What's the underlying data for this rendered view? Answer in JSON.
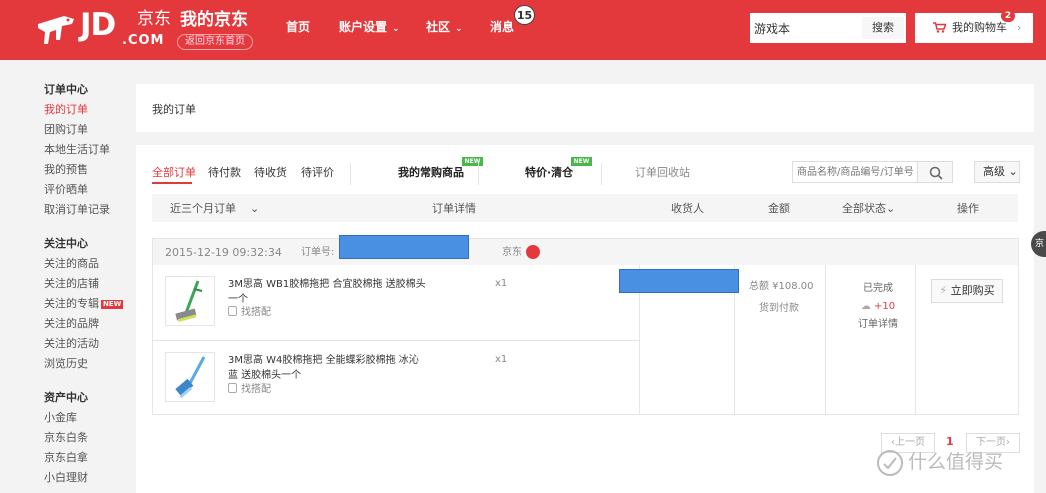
{
  "header": {
    "logo_jd": "JD",
    "logo_cn": "京东",
    "logo_com": ".COM",
    "my_jd": "我的京东",
    "back_home": "返回京东首页",
    "nav": [
      {
        "label": "首页"
      },
      {
        "label": "账户设置",
        "caret": "⌄"
      },
      {
        "label": "社区",
        "caret": "⌄"
      },
      {
        "label": "消息"
      }
    ],
    "message_count": "15",
    "search_value": "游戏本",
    "search_button": "搜索",
    "cart_label": "我的购物车",
    "cart_count": "2",
    "cart_arrow": "›"
  },
  "sidebar": {
    "groups": [
      {
        "title": "订单中心",
        "items": [
          "我的订单",
          "团购订单",
          "本地生活订单",
          "我的预售",
          "评价晒单",
          "取消订单记录"
        ]
      },
      {
        "title": "关注中心",
        "items": [
          "关注的商品",
          "关注的店铺",
          "关注的专辑",
          "关注的品牌",
          "关注的活动",
          "浏览历史"
        ]
      },
      {
        "title": "资产中心",
        "items": [
          "小金库",
          "京东白条",
          "京东白拿",
          "小白理财"
        ]
      }
    ],
    "new_tag": "NEW"
  },
  "page_title": "我的订单",
  "tabs": {
    "all": "全部订单",
    "pending_pay": "待付款",
    "pending_receive": "待收货",
    "pending_review": "待评价",
    "frequent": "我的常购商品",
    "clearance": "特价·清仓",
    "recycle": "订单回收站",
    "new_badge": "NEW"
  },
  "order_search": {
    "placeholder": "商品名称/商品编号/订单号",
    "advanced": "高级",
    "advanced_caret": "⌄"
  },
  "table_header": {
    "period": "近三个月订单",
    "period_caret": "⌄",
    "details": "订单详情",
    "receiver": "收货人",
    "amount": "金额",
    "status": "全部状态",
    "status_caret": "⌄",
    "actions": "操作"
  },
  "order": {
    "date": "2015-12-19 09:32:34",
    "number_label": "订单号:",
    "shop": "京东",
    "products": [
      {
        "name": "3M思高 WB1胶棉拖把 合宜胶棉拖 送胶棉头一个",
        "qty": "x1",
        "pair": "找搭配"
      },
      {
        "name": "3M思高 W4胶棉拖把 全能蝶彩胶棉拖 冰沁蓝 送胶棉头一个",
        "qty": "x1",
        "pair": "找搭配"
      }
    ],
    "total": "总额 ¥108.00",
    "payment": "货到付款",
    "status": "已完成",
    "beans": "+10",
    "detail_link": "订单详情",
    "buy_again": "立即购买"
  },
  "pager": {
    "prev": "‹上一页",
    "current": "1",
    "next": "下一页›"
  },
  "watermark": "什么值得买",
  "side_bubble": "京",
  "colors": {
    "brand_red": "#e4393c",
    "new_green": "#48b84a",
    "redaction_blue": "#4a90e2"
  }
}
